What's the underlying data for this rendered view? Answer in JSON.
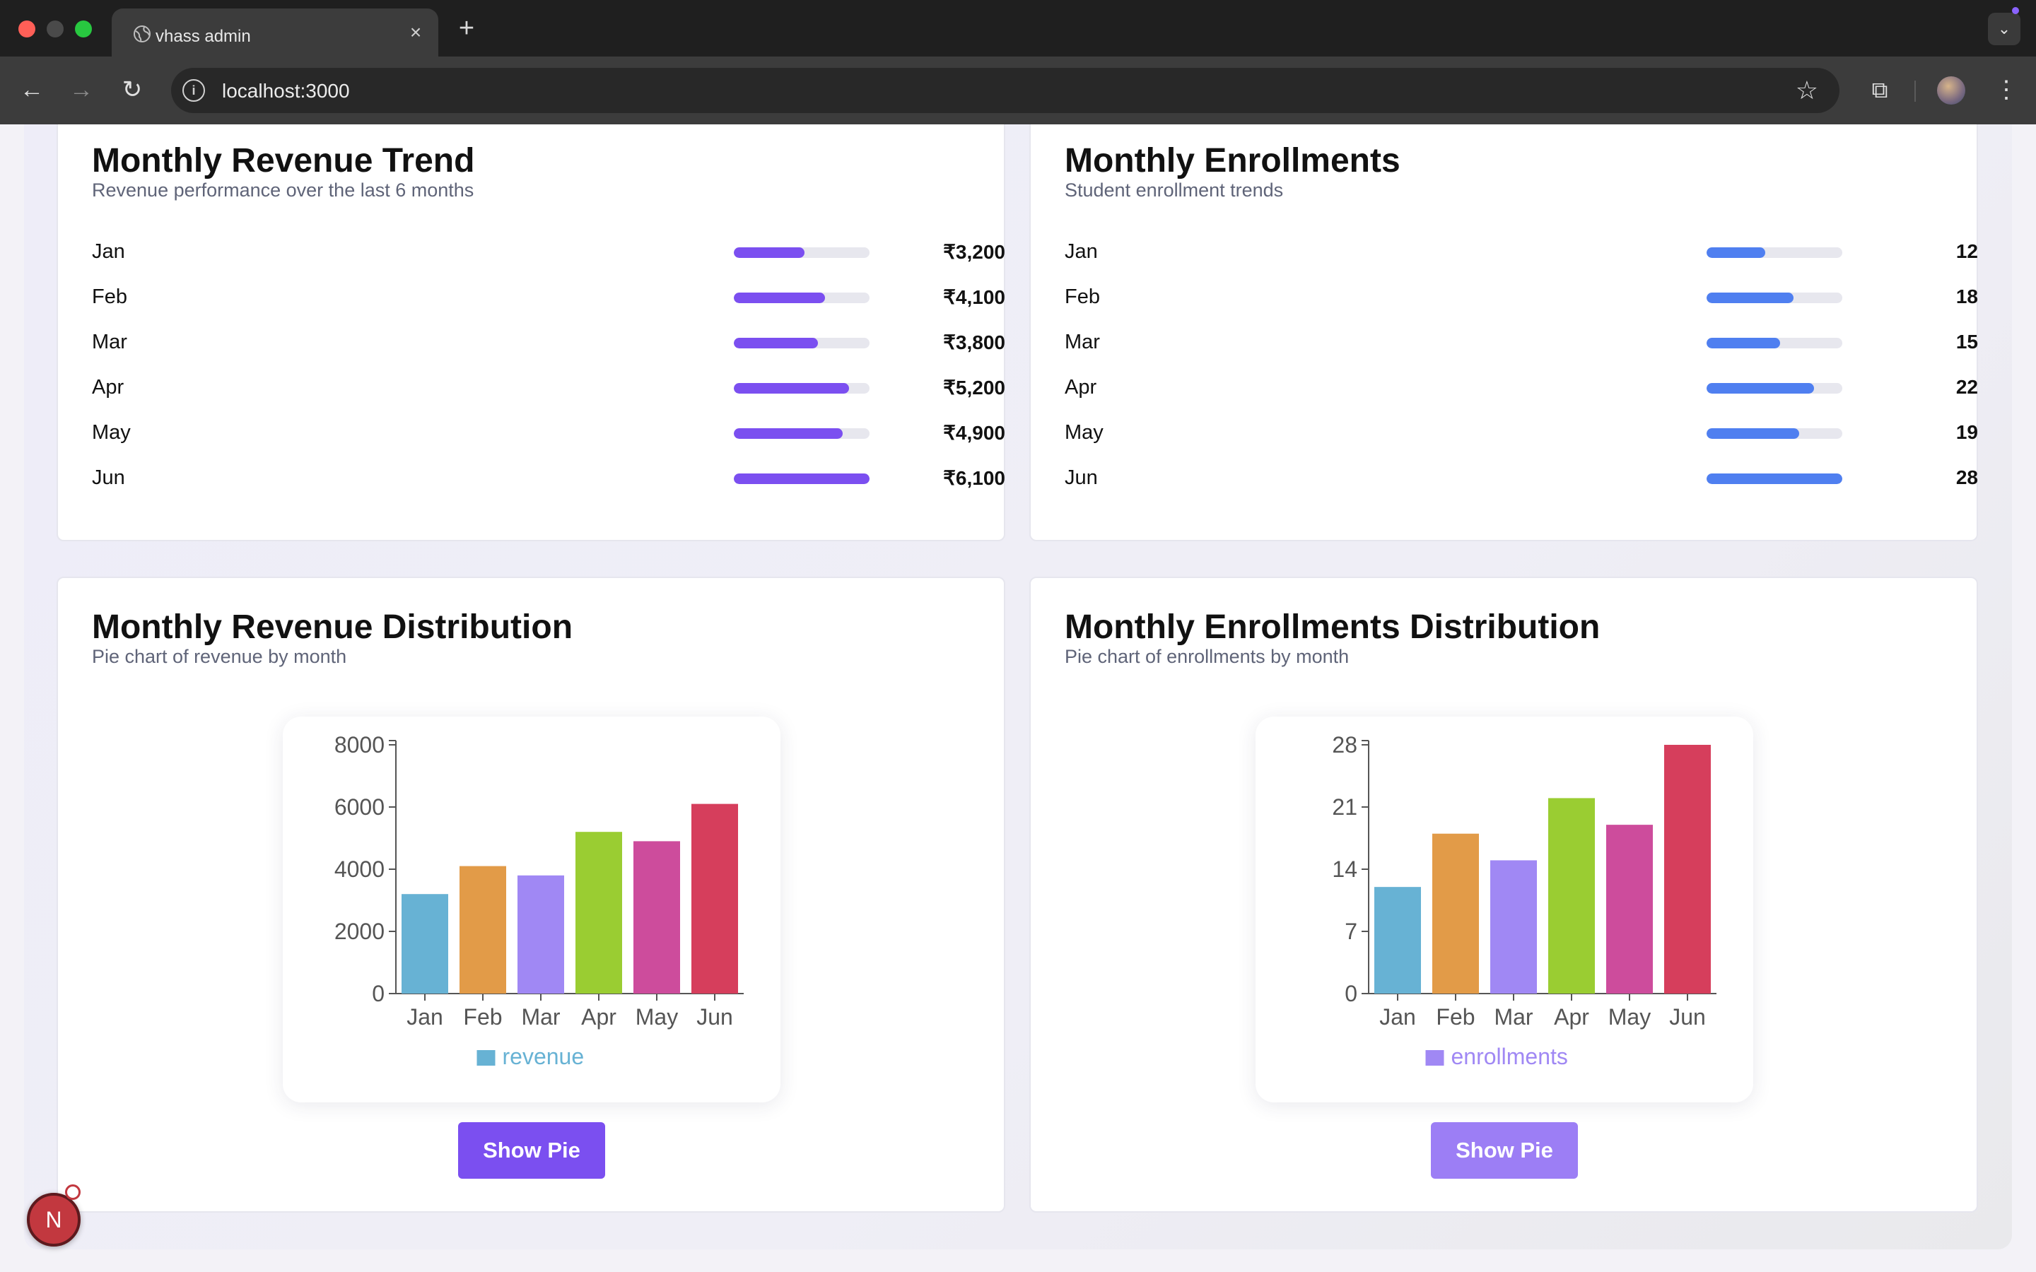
{
  "browser": {
    "tab_title": "vhass admin",
    "new_tab": "+",
    "tab_close": "×",
    "url": "localhost:3000",
    "tab_menu": "⌄"
  },
  "revenue_trend": {
    "title": "Monthly Revenue Trend",
    "subtitle": "Revenue performance over the last 6 months",
    "bar_color": "#7b4ff0",
    "rows": [
      {
        "label": "Jan",
        "value": "₹3,200",
        "fraction": 0.52
      },
      {
        "label": "Feb",
        "value": "₹4,100",
        "fraction": 0.67
      },
      {
        "label": "Mar",
        "value": "₹3,800",
        "fraction": 0.62
      },
      {
        "label": "Apr",
        "value": "₹5,200",
        "fraction": 0.85
      },
      {
        "label": "May",
        "value": "₹4,900",
        "fraction": 0.8
      },
      {
        "label": "Jun",
        "value": "₹6,100",
        "fraction": 1.0
      }
    ]
  },
  "enrollments_trend": {
    "title": "Monthly Enrollments",
    "subtitle": "Student enrollment trends",
    "bar_color": "#4f7ff0",
    "rows": [
      {
        "label": "Jan",
        "value": "12",
        "fraction": 0.43
      },
      {
        "label": "Feb",
        "value": "18",
        "fraction": 0.64
      },
      {
        "label": "Mar",
        "value": "15",
        "fraction": 0.54
      },
      {
        "label": "Apr",
        "value": "22",
        "fraction": 0.79
      },
      {
        "label": "May",
        "value": "19",
        "fraction": 0.68
      },
      {
        "label": "Jun",
        "value": "28",
        "fraction": 1.0
      }
    ]
  },
  "revenue_distribution": {
    "title": "Monthly Revenue Distribution",
    "subtitle": "Pie chart of revenue by month",
    "button_label": "Show Pie",
    "button_color": "#7b4ff0"
  },
  "enrollments_distribution": {
    "title": "Monthly Enrollments Distribution",
    "subtitle": "Pie chart of enrollments by month",
    "button_label": "Show Pie",
    "button_color": "#9c7ef5"
  },
  "dev_badge": "N",
  "chart_data": [
    {
      "type": "bar",
      "categories": [
        "Jan",
        "Feb",
        "Mar",
        "Apr",
        "May",
        "Jun"
      ],
      "series": [
        {
          "name": "revenue",
          "values": [
            3200,
            4100,
            3800,
            5200,
            4900,
            6100
          ]
        }
      ],
      "colors": [
        "#67b2d4",
        "#e29b48",
        "#a088f4",
        "#9acd32",
        "#cd4c9c",
        "#d63e5c"
      ],
      "legend_color": "#67b2d4",
      "yticks": [
        0,
        2000,
        4000,
        6000,
        8000
      ],
      "ylim": [
        0,
        8000
      ],
      "legend": "bottom"
    },
    {
      "type": "bar",
      "categories": [
        "Jan",
        "Feb",
        "Mar",
        "Apr",
        "May",
        "Jun"
      ],
      "series": [
        {
          "name": "enrollments",
          "values": [
            12,
            18,
            15,
            22,
            19,
            28
          ]
        }
      ],
      "colors": [
        "#67b2d4",
        "#e29b48",
        "#a088f4",
        "#9acd32",
        "#cd4c9c",
        "#d63e5c"
      ],
      "legend_color": "#a088f4",
      "yticks": [
        0,
        7,
        14,
        21,
        28
      ],
      "ylim": [
        0,
        28
      ],
      "legend": "bottom"
    }
  ]
}
